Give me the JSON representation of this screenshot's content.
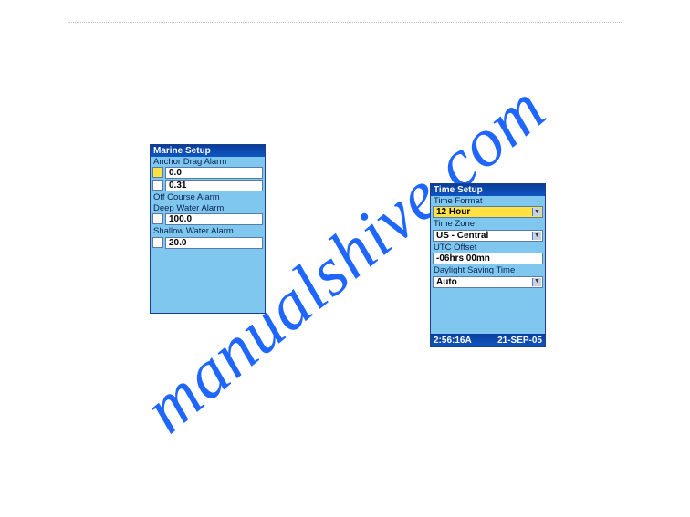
{
  "watermark": "manualshive.com",
  "marine": {
    "title": "Marine Setup",
    "anchor_label": "Anchor Drag Alarm",
    "anchor_value": "0.0",
    "anchor_value2": "0.31",
    "offcourse_label": "Off Course Alarm",
    "deep_label": "Deep Water Alarm",
    "deep_value": "100.0",
    "shallow_label": "Shallow Water Alarm",
    "shallow_value": "20.0"
  },
  "time": {
    "title": "Time Setup",
    "format_label": "Time Format",
    "format_value": "12 Hour",
    "zone_label": "Time Zone",
    "zone_value": "US - Central",
    "utc_label": "UTC Offset",
    "utc_value": "-06hrs 00mn",
    "dst_label": "Daylight Saving Time",
    "dst_value": "Auto",
    "status_time": "2:56:16A",
    "status_date": "21-SEP-05"
  }
}
